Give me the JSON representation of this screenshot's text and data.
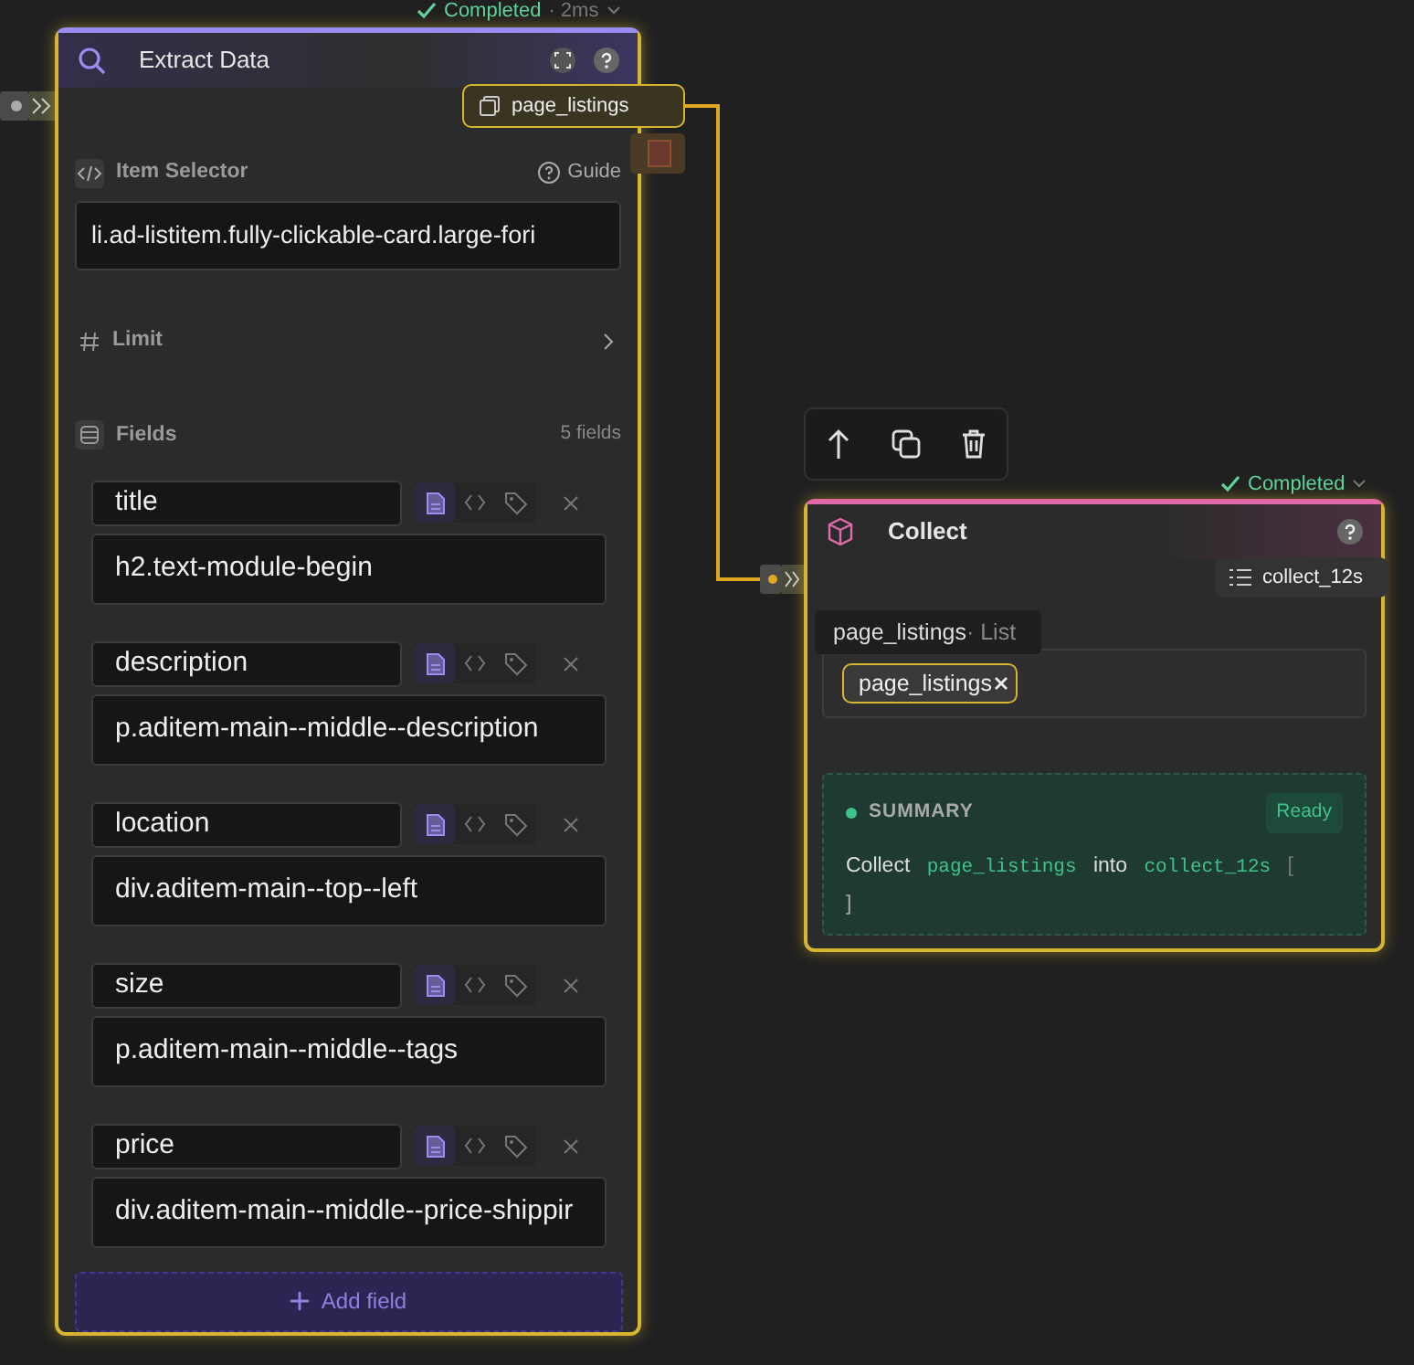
{
  "extract_node": {
    "status": "Completed",
    "duration": "· 2ms",
    "title": "Extract Data",
    "output": "page_listings",
    "item_selector": {
      "label": "Item Selector",
      "guide": "Guide",
      "value": "li.ad-listitem.fully-clickable-card.large-fori"
    },
    "limit": {
      "label": "Limit",
      "expanded": false
    },
    "fields_label": "Fields",
    "fields_count": "5 fields",
    "fields": [
      {
        "name": "title",
        "selector": "h2.text-module-begin",
        "text_mode": true
      },
      {
        "name": "description",
        "selector": "p.aditem-main--middle--description",
        "text_mode": true
      },
      {
        "name": "location",
        "selector": "div.aditem-main--top--left",
        "text_mode": true
      },
      {
        "name": "size",
        "selector": "p.aditem-main--middle--tags",
        "text_mode": true
      },
      {
        "name": "price",
        "selector": "div.aditem-main--middle--price-shippir",
        "text_mode": true
      }
    ],
    "add_field": "Add field"
  },
  "collect_node": {
    "status": "Completed",
    "title": "Collect",
    "output": "collect_12s",
    "tooltip": {
      "name": "page_listings",
      "type": "· List"
    },
    "value_chip": "page_listings",
    "summary": {
      "label": "SUMMARY",
      "badge": "Ready",
      "prefix": "Collect",
      "source": "page_listings",
      "middle": "into",
      "target": "collect_12s",
      "open_bracket": "[",
      "close_bracket": "]"
    }
  }
}
